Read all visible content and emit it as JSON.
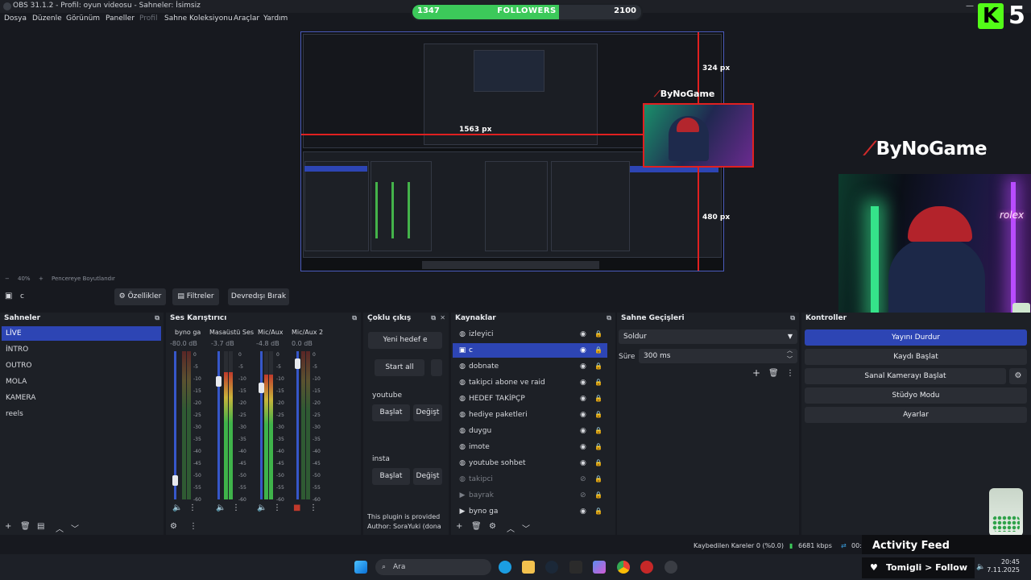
{
  "window": {
    "title": "OBS 31.1.2 - Profil: oyun videosu - Sahneler: İsimsiz"
  },
  "menu": [
    "Dosya",
    "Düzenle",
    "Görünüm",
    "Paneller",
    "Profil",
    "Sahne Koleksiyonu",
    "Araçlar",
    "Yardım"
  ],
  "overlay": {
    "followers_current": "1347",
    "followers_label": "FOLLOWERS",
    "followers_goal": "2100",
    "followers_progress": 0.641,
    "kick_letter": "K",
    "kick_number": "5",
    "brand": "ByNoGame",
    "px_top": "324 px",
    "px_left": "1563 px",
    "px_bottom": "480 px",
    "activity_feed": "Activity Feed",
    "follow_banner": "Tomigli > Follow",
    "camera_neon": "rolex"
  },
  "zoom": {
    "level": "40%",
    "fit_label": "Pencereye Boyutlandır"
  },
  "source_toolbar": {
    "selected_source": "c",
    "properties": "Özellikler",
    "filters": "Filtreler",
    "deactivate": "Devredışı Bırak"
  },
  "scenes": {
    "title": "Sahneler",
    "items": [
      "LİVE",
      "İNTRO",
      "OUTRO",
      "MOLA",
      "KAMERA",
      "reels"
    ]
  },
  "mixer": {
    "title": "Ses Karıştırıcı",
    "channels": [
      {
        "name": "byno ga",
        "db": "-80.0 dB",
        "fader": 0.1
      },
      {
        "name": "Masaüstü Ses",
        "db": "-3.7 dB",
        "fader": 0.82
      },
      {
        "name": "Mic/Aux",
        "db": "-4.8 dB",
        "fader": 0.77
      },
      {
        "name": "Mic/Aux 2",
        "db": "0.0 dB",
        "fader": 0.95
      }
    ],
    "scale": [
      "0",
      "-5",
      "-10",
      "-15",
      "-20",
      "-25",
      "-30",
      "-35",
      "-40",
      "-45",
      "-50",
      "-55",
      "-60"
    ]
  },
  "multi": {
    "title": "Çoklu çıkış",
    "new_target": "Yeni hedef e",
    "start_all": "Start all",
    "targets": [
      {
        "name": "youtube",
        "start": "Başlat",
        "edit": "Değişt"
      },
      {
        "name": "insta",
        "start": "Başlat",
        "edit": "Değişt"
      }
    ],
    "plugin_note": "This plugin is provided f",
    "author_note": "Author: SoraYuki (dona"
  },
  "sources": {
    "title": "Kaynaklar",
    "items": [
      {
        "name": "izleyici",
        "icon": "globe-icon",
        "active": false,
        "hidden": false
      },
      {
        "name": "c",
        "icon": "camera-icon",
        "active": true,
        "hidden": false
      },
      {
        "name": "dobnate",
        "icon": "globe-icon",
        "active": false,
        "hidden": false
      },
      {
        "name": "takipci abone ve raid",
        "icon": "globe-icon",
        "active": false,
        "hidden": false
      },
      {
        "name": "HEDEF TAKİPÇP",
        "icon": "globe-icon",
        "active": false,
        "hidden": false
      },
      {
        "name": "hediye paketleri",
        "icon": "globe-icon",
        "active": false,
        "hidden": false
      },
      {
        "name": "duygu",
        "icon": "globe-icon",
        "active": false,
        "hidden": false
      },
      {
        "name": "imote",
        "icon": "globe-icon",
        "active": false,
        "hidden": false
      },
      {
        "name": "youtube sohbet",
        "icon": "globe-icon",
        "active": false,
        "hidden": false
      },
      {
        "name": "takipci",
        "icon": "globe-icon",
        "active": false,
        "hidden": true
      },
      {
        "name": "bayrak",
        "icon": "play-icon",
        "active": false,
        "hidden": true
      },
      {
        "name": "byno ga",
        "icon": "play-icon",
        "active": false,
        "hidden": false
      }
    ]
  },
  "transitions": {
    "title": "Sahne Geçişleri",
    "selected": "Soldur",
    "duration_label": "Süre",
    "duration_value": "300 ms"
  },
  "controls": {
    "title": "Kontroller",
    "stop_stream": "Yayını Durdur",
    "start_record": "Kaydı Başlat",
    "virtual_cam": "Sanal Kamerayı Başlat",
    "studio_mode": "Stüdyo Modu",
    "settings": "Ayarlar"
  },
  "status": {
    "dropped_frames": "Kaybedilen Kareler 0 (%0.0)",
    "bitrate": "6681 kbps",
    "time_partial": "00:"
  },
  "taskbar": {
    "search_placeholder": "Ara",
    "time": "20:45",
    "date": "7.11.2025"
  },
  "colors": {
    "accent": "#2d45b4",
    "kick_green": "#53fc18",
    "followers_green": "#3cc95a",
    "guide_red": "#e02020"
  }
}
